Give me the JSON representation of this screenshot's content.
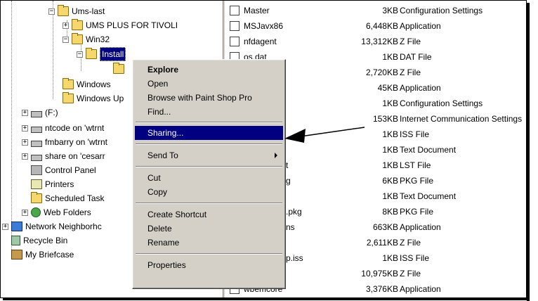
{
  "tree": {
    "items": [
      {
        "label": "Ums-last",
        "icon": "folder-icon"
      },
      {
        "label": "UMS PLUS FOR TIVOLI",
        "icon": "folder-icon"
      },
      {
        "label": "Win32",
        "icon": "folder-icon"
      },
      {
        "label": "Install",
        "icon": "folder-open-icon"
      },
      {
        "label": "",
        "icon": "folder-icon"
      },
      {
        "label": "Windows",
        "icon": "folder-icon"
      },
      {
        "label": "Windows Up",
        "icon": "folder-icon"
      },
      {
        "label": "(F:)",
        "icon": "drive-icon"
      },
      {
        "label": "ntcode on 'wtrnt",
        "icon": "network-drive-icon"
      },
      {
        "label": "fmbarry on 'wtrnt",
        "icon": "network-drive-icon"
      },
      {
        "label": "share on 'cesarr",
        "icon": "network-drive-icon"
      },
      {
        "label": "Control Panel",
        "icon": "control-panel-icon"
      },
      {
        "label": "Printers",
        "icon": "printer-icon"
      },
      {
        "label": "Scheduled Task",
        "icon": "scheduled-tasks-icon"
      },
      {
        "label": "Web Folders",
        "icon": "web-folders-icon"
      },
      {
        "label": "Network Neighborhc",
        "icon": "network-neighborhood-icon"
      },
      {
        "label": "Recycle Bin",
        "icon": "recycle-bin-icon"
      },
      {
        "label": "My Briefcase",
        "icon": "briefcase-icon"
      }
    ]
  },
  "files": {
    "rows": [
      {
        "name": "Master",
        "size": "3KB",
        "type": "Configuration Settings"
      },
      {
        "name": "MSJavx86",
        "size": "6,448KB",
        "type": "Application"
      },
      {
        "name": "nfdagent",
        "size": "13,312KB",
        "type": "Z File"
      },
      {
        "name": "os.dat",
        "size": "1KB",
        "type": "DAT File"
      },
      {
        "name": "",
        "size": "2,720KB",
        "type": "Z File"
      },
      {
        "name": "",
        "size": "45KB",
        "type": "Application"
      },
      {
        "name": "",
        "size": "1KB",
        "type": "Configuration Settings"
      },
      {
        "name": "",
        "size": "153KB",
        "type": "Internet Communication Settings"
      },
      {
        "name": "",
        "size": "1KB",
        "type": "ISS File"
      },
      {
        "name": "",
        "size": "1KB",
        "type": "Text Document"
      },
      {
        "name": "t",
        "size": "1KB",
        "type": "LST File"
      },
      {
        "name": "g",
        "size": "6KB",
        "type": "PKG File"
      },
      {
        "name": "",
        "size": "1KB",
        "type": "Text Document"
      },
      {
        "name": ".pkg",
        "size": "8KB",
        "type": "PKG File"
      },
      {
        "name": "ns",
        "size": "663KB",
        "type": "Application"
      },
      {
        "name": "",
        "size": "2,611KB",
        "type": "Z File"
      },
      {
        "name": "p.iss",
        "size": "1KB",
        "type": "ISS File"
      },
      {
        "name": "",
        "size": "10,975KB",
        "type": "Z File"
      },
      {
        "name": "wbemcore",
        "size": "3,376KB",
        "type": "Application"
      }
    ]
  },
  "context_menu": {
    "items": [
      {
        "label": "Explore"
      },
      {
        "label": "Open"
      },
      {
        "label": "Browse with Paint Shop Pro"
      },
      {
        "label": "Find..."
      },
      {
        "label": "Sharing..."
      },
      {
        "label": "Send To"
      },
      {
        "label": "Cut"
      },
      {
        "label": "Copy"
      },
      {
        "label": "Create Shortcut"
      },
      {
        "label": "Delete"
      },
      {
        "label": "Rename"
      },
      {
        "label": "Properties"
      }
    ],
    "highlighted": "Sharing..."
  },
  "colors": {
    "selection": "#000080",
    "menu_bg": "#d4d0c8",
    "folder": "#f5d76e"
  }
}
